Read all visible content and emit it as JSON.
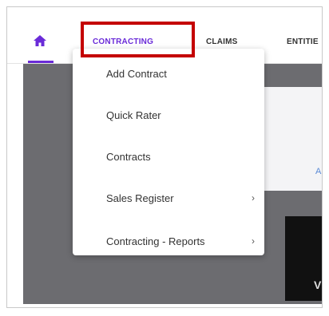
{
  "nav": {
    "home_icon": "home-icon",
    "items": [
      {
        "label": "CONTRACTING",
        "active": true
      },
      {
        "label": "CLAIMS",
        "active": false
      },
      {
        "label": "ENTITIE",
        "active": false
      }
    ]
  },
  "dropdown": {
    "items": [
      {
        "label": "Add Contract",
        "has_submenu": false
      },
      {
        "label": "Quick Rater",
        "has_submenu": false
      },
      {
        "label": "Contracts",
        "has_submenu": false
      },
      {
        "label": "Sales Register",
        "has_submenu": true,
        "chevron": "›"
      },
      {
        "label": "Contracting - Reports",
        "has_submenu": true,
        "chevron": "›"
      }
    ]
  },
  "background": {
    "panel_letter": "A",
    "dark_letter": "V"
  },
  "colors": {
    "accent": "#6a2bd8",
    "highlight": "#c40000",
    "backdrop": "#6c6c70"
  }
}
